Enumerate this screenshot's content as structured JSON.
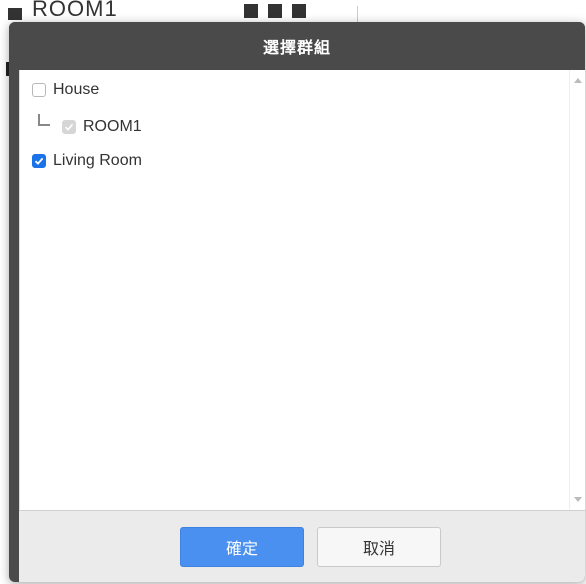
{
  "background": {
    "row_label": "ROOM1"
  },
  "dialog": {
    "title": "選擇群組",
    "items": [
      {
        "label": "House",
        "state": "unchecked"
      },
      {
        "label": "ROOM1",
        "state": "checked-disabled"
      },
      {
        "label": "Living Room",
        "state": "checked"
      }
    ],
    "confirm_label": "確定",
    "cancel_label": "取消"
  },
  "colors": {
    "header": "#4a4a4a",
    "primary_button": "#4a90f0",
    "checkbox_checked": "#1a73e8",
    "footer": "#ebebeb"
  }
}
